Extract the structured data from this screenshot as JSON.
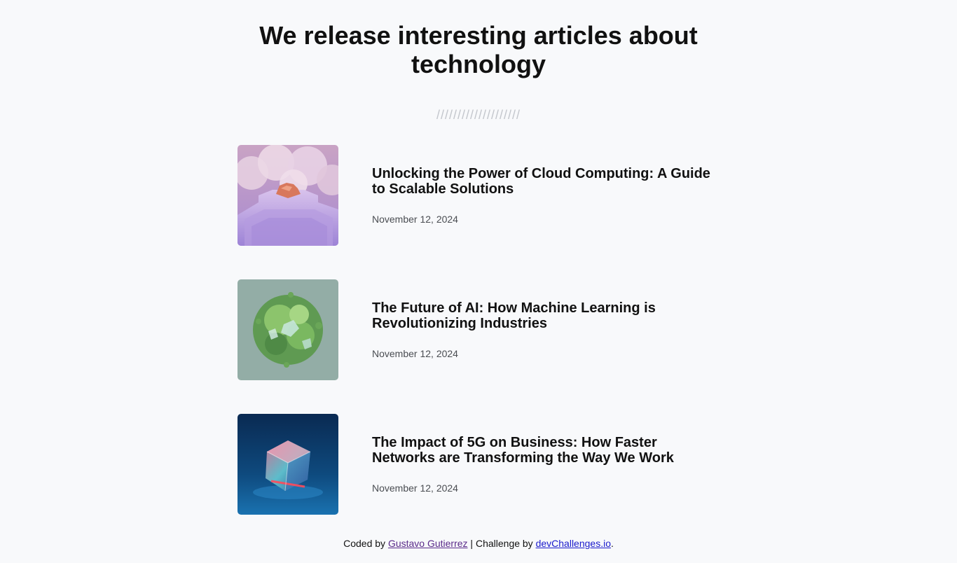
{
  "header": {
    "title_line1": "We release interesting articles about",
    "title_line2": "technology",
    "divider": "////////////////////"
  },
  "articles": [
    {
      "title": "Unlocking the Power of Cloud Computing: A Guide to Scalable Solutions",
      "date": "November 12, 2024",
      "image_icon": "cloud-stairs-image"
    },
    {
      "title": "The Future of AI: How Machine Learning is Revolutionizing Industries",
      "date": "November 12, 2024",
      "image_icon": "green-crystal-sphere-image"
    },
    {
      "title": "The Impact of 5G on Business: How Faster Networks are Transforming the Way We Work",
      "date": "November 12, 2024",
      "image_icon": "glowing-cube-image"
    }
  ],
  "footer": {
    "prefix": "Coded by ",
    "author": "Gustavo Gutierrez",
    "middle": " | Challenge by ",
    "site": "devChallenges.io",
    "suffix": "."
  },
  "colors": {
    "background": "#f8f9fb",
    "text": "#111111",
    "date": "#4a4d52",
    "divider": "#c3c6cc",
    "author_link": "#5a2a8a",
    "site_link": "#1a1acc"
  }
}
